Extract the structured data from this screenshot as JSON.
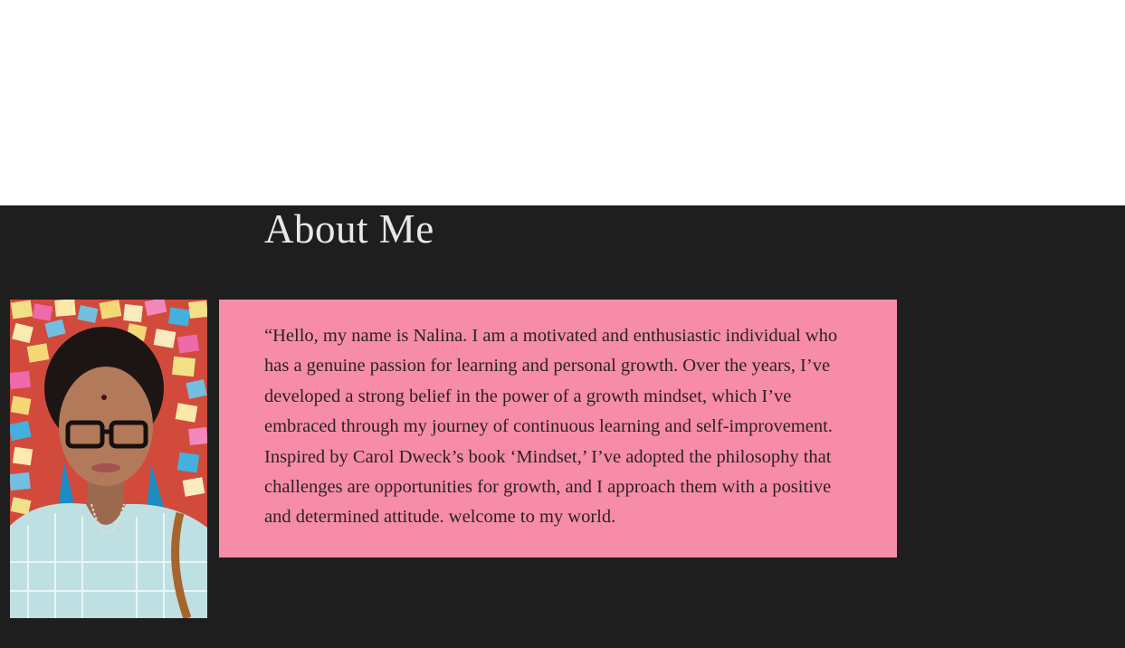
{
  "about": {
    "heading": "About Me",
    "quote": "“Hello, my name is Nalina. I am a motivated and enthusiastic individual who has a genuine passion for learning and personal growth. Over the years, I’ve developed a strong belief in the power of a growth mindset, which I’ve embraced through my journey of continuous learning and self-improvement. Inspired by Carol Dweck’s book ‘Mindset,’ I’ve adopted the philosophy that challenges are opportunities for growth, and I approach them with a positive and determined attitude. welcome to my world."
  },
  "colors": {
    "section_background": "#1e1e1e",
    "card_background": "#f78ca8",
    "heading_text": "#e8e8e8",
    "body_text": "#2a2226"
  }
}
